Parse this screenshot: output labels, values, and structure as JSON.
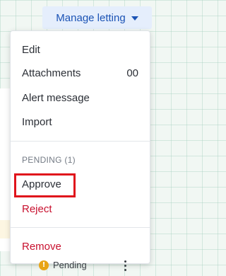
{
  "header": {
    "manage_label": "Manage letting"
  },
  "menu": {
    "edit": "Edit",
    "attachments": "Attachments",
    "attachments_count": "00",
    "alert": "Alert message",
    "import": "Import",
    "section_label": "PENDING (1)",
    "approve": "Approve",
    "reject": "Reject",
    "remove": "Remove"
  },
  "background_row": {
    "status": "Pending",
    "status_icon": "warning-icon"
  },
  "colors": {
    "accent": "#1b53b5",
    "danger": "#c8102e",
    "highlight": "#e0141c",
    "warning": "#e8a417"
  }
}
